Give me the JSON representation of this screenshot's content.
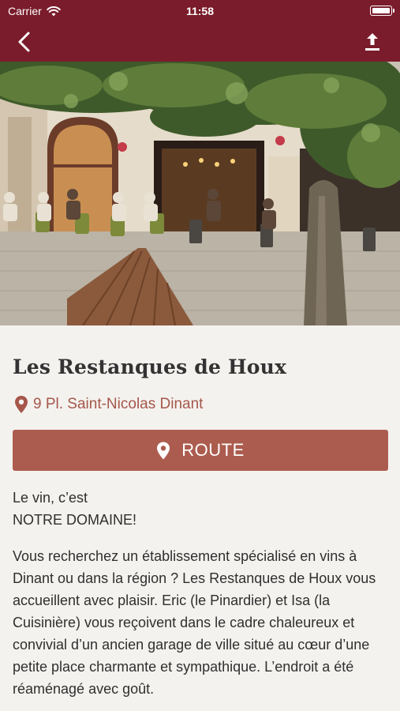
{
  "status_bar": {
    "carrier": "Carrier",
    "time": "11:58"
  },
  "nav": {
    "back_icon": "chevron-left-icon",
    "share_icon": "share-upload-icon"
  },
  "colors": {
    "brand": "#7a1c2b",
    "accent": "#ac5c4e",
    "address": "#a5574a",
    "background": "#f4f2ef"
  },
  "place": {
    "name": "Les Restanques de Houx",
    "address": "9 Pl. Saint-Nicolas Dinant",
    "route_label": "ROUTE"
  },
  "description": {
    "intro_line1": "Le vin, c’est",
    "intro_line2": "NOTRE DOMAINE!",
    "body": "Vous recherchez un établissement spécialisé en vins à Dinant ou dans la région ? Les Restanques de Houx vous accueillent avec plaisir. Eric (le Pinardier) et Isa (la Cuisinière) vous reçoivent dans le cadre chaleureux et convivial d’un ancien garage de ville situé au cœur d’une petite place charmante et sympathique. L’endroit a été réaménagé avec goût."
  }
}
